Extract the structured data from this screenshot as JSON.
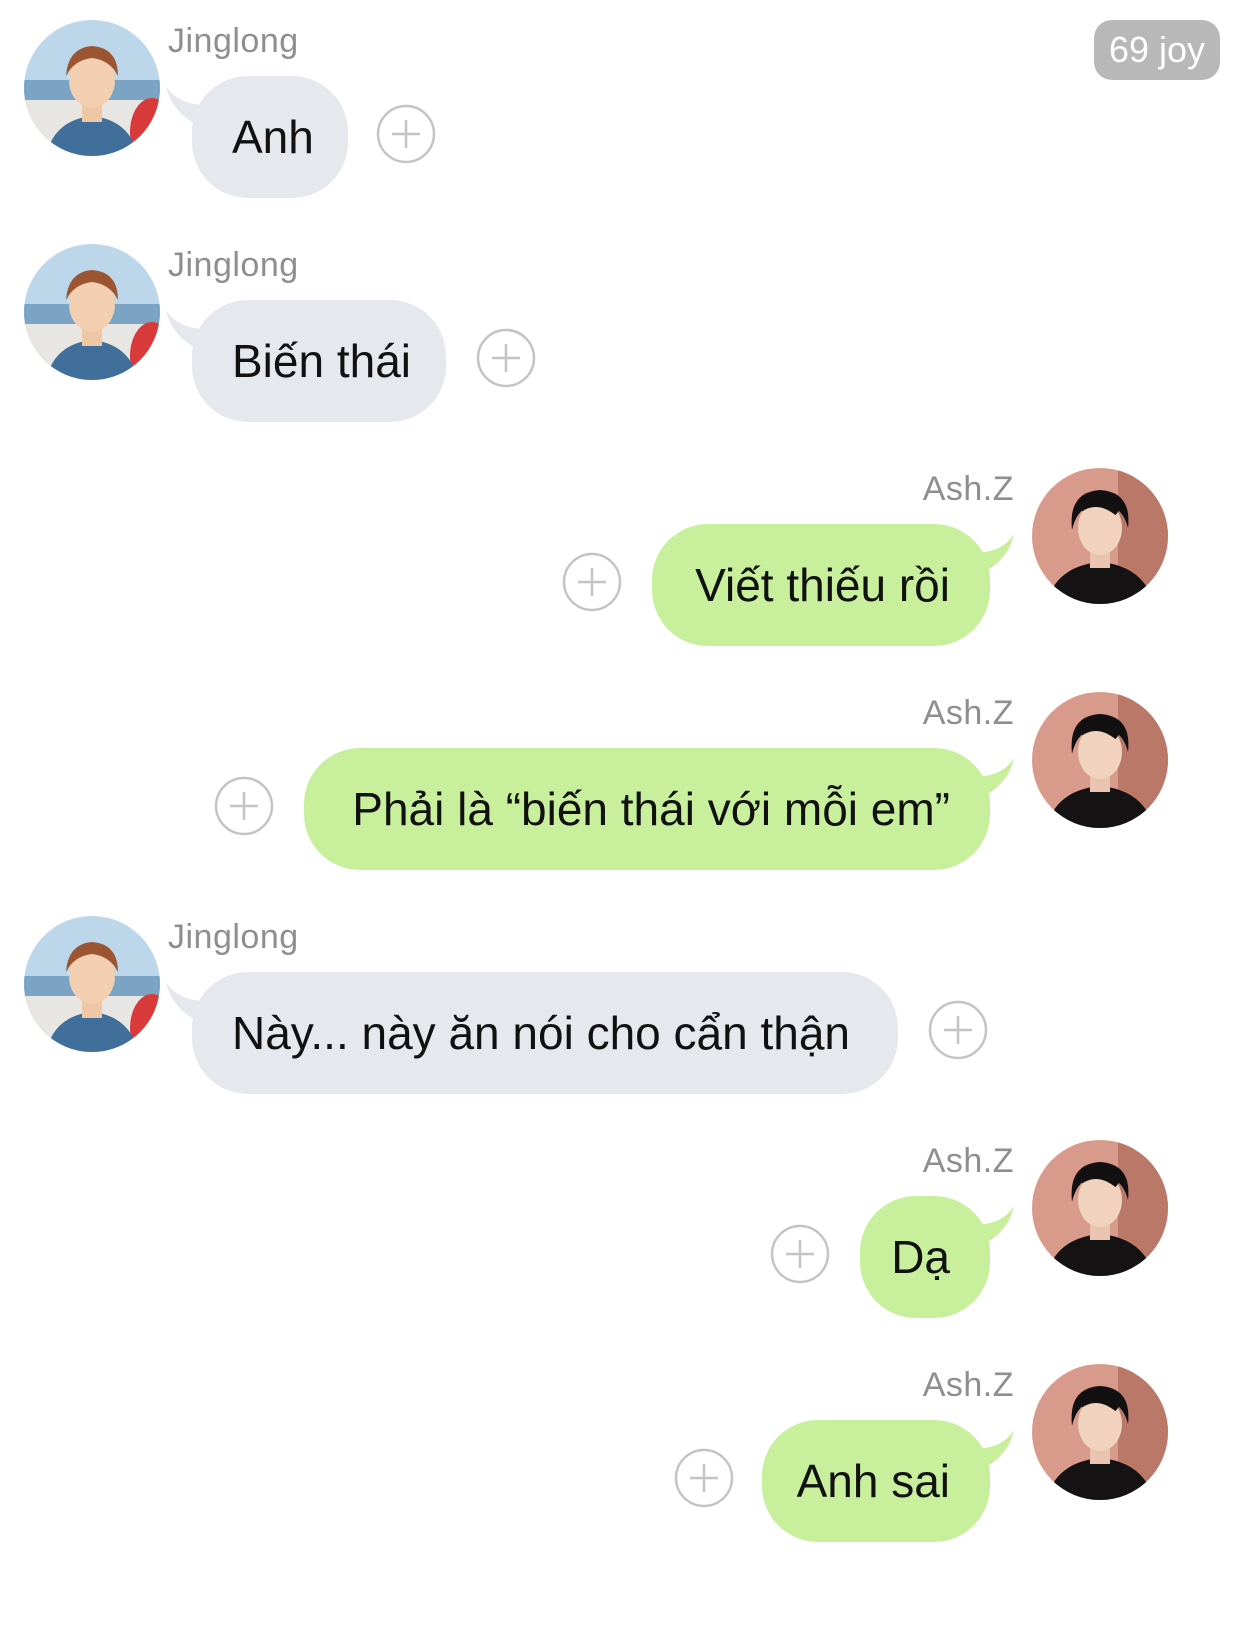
{
  "header": {
    "badge_text": "69 joy"
  },
  "participants": {
    "jinglong": {
      "name": "Jinglong",
      "avatar": "avatar-jinglong"
    },
    "ashz": {
      "name": "Ash.Z",
      "avatar": "avatar-ashz"
    }
  },
  "messages": [
    {
      "sender": "Jinglong",
      "side": "incoming",
      "text": "Anh",
      "action_icon": "plus-circle-icon"
    },
    {
      "sender": "Jinglong",
      "side": "incoming",
      "text": "Biến thái",
      "action_icon": "plus-circle-icon"
    },
    {
      "sender": "Ash.Z",
      "side": "outgoing",
      "text": "Viết thiếu rồi",
      "action_icon": "plus-circle-icon"
    },
    {
      "sender": "Ash.Z",
      "side": "outgoing",
      "text": "Phải là “biến thái với mỗi em”",
      "action_icon": "plus-circle-icon"
    },
    {
      "sender": "Jinglong",
      "side": "incoming",
      "text": "Này... này ăn nói cho cẩn thận",
      "action_icon": "plus-circle-icon"
    },
    {
      "sender": "Ash.Z",
      "side": "outgoing",
      "text": "Dạ",
      "action_icon": "plus-circle-icon"
    },
    {
      "sender": "Ash.Z",
      "side": "outgoing",
      "text": "Anh sai",
      "action_icon": "plus-circle-icon"
    }
  ],
  "colors": {
    "incoming_bubble": "#e5e8ec",
    "outgoing_bubble": "#c8ef9c",
    "badge_background": "#b8b8b8",
    "sender_name": "#8e8e8e",
    "plus_icon": "#c4c4c4"
  }
}
